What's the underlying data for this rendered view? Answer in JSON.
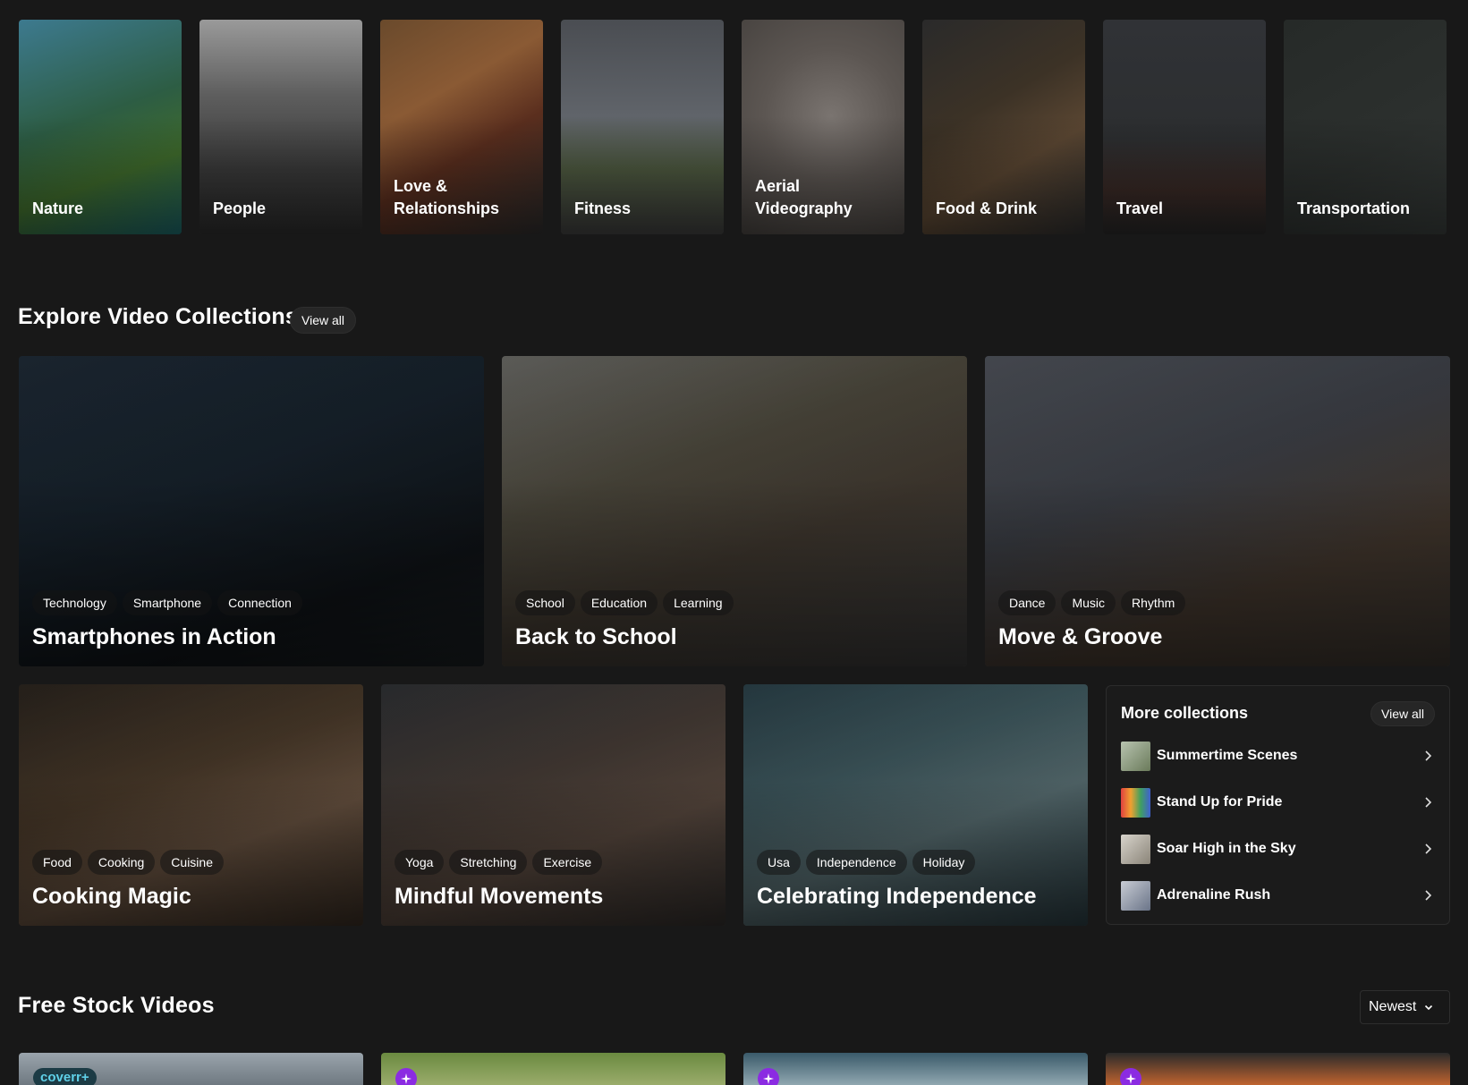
{
  "categories": [
    {
      "label": "Nature",
      "bg": "linear-gradient(160deg,#3d7a8f 0%,#2d5d44 45%,#3f6b2c 70%,#1a5f63 100%)"
    },
    {
      "label": "People",
      "bg": "linear-gradient(180deg,#9a9a9a 0%,#5e5e5e 35%,#3a3a3a 70%,#2a2a2a 100%)"
    },
    {
      "label": "Love &\nRelationships",
      "bg": "linear-gradient(150deg,#6a4a2c 0%,#8a5a34 35%,#5a2e1e 60%,#2a2a2a 100%)"
    },
    {
      "label": "Fitness",
      "bg": "linear-gradient(180deg,#4a4d52 0%,#60646a 45%,#4e5a40 70%,#3b3b3b 100%)"
    },
    {
      "label": "Aerial\nVideography",
      "bg": "radial-gradient(circle at 55% 45%,#7a7470 0%,#5c5652 45%,#44403d 100%)"
    },
    {
      "label": "Food & Drink",
      "bg": "linear-gradient(150deg,#2a2a2a 0%,#3c3226 40%,#5a4632 65%,#2c2c2c 100%)"
    },
    {
      "label": "Travel",
      "bg": "linear-gradient(180deg,#303236 0%,#2c2e30 55%,#3a2a26 80%,#262626 100%)"
    },
    {
      "label": "Transportation",
      "bg": "linear-gradient(150deg,#262a28 0%,#2c302e 60%,#353a38 100%)"
    }
  ],
  "explore": {
    "title": "Explore Video Collections",
    "view_all": "View all"
  },
  "collections_top": [
    {
      "title": "Smartphones in Action",
      "tags": [
        "Technology",
        "Smartphone",
        "Connection"
      ],
      "bg": "linear-gradient(160deg,#1e2a36 0%,#17222c 40%,#101418 75%,#1a1f22 100%)"
    },
    {
      "title": "Back to School",
      "tags": [
        "School",
        "Education",
        "Learning"
      ],
      "bg": "linear-gradient(160deg,#6a6a66 0%,#4e4a3e 35%,#433b32 60%,#3a3a3a 100%)"
    },
    {
      "title": "Move & Groove",
      "tags": [
        "Dance",
        "Music",
        "Rhythm"
      ],
      "bg": "linear-gradient(160deg,#4e525a 0%,#3e4148 40%,#463a30 70%,#3c3630 100%)"
    }
  ],
  "collections_bottom": [
    {
      "title": "Cooking Magic",
      "tags": [
        "Food",
        "Cooking",
        "Cuisine"
      ],
      "bg": "linear-gradient(160deg,#2a241e 0%,#4a3a2a 40%,#6a5442 65%,#3a2e24 100%)"
    },
    {
      "title": "Mindful Movements",
      "tags": [
        "Yoga",
        "Stretching",
        "Exercise"
      ],
      "bg": "linear-gradient(160deg,#2e3034 0%,#463c36 40%,#5a4a40 65%,#34302e 100%)"
    },
    {
      "title": "Celebrating Independence",
      "tags": [
        "Usa",
        "Independence",
        "Holiday"
      ],
      "bg": "linear-gradient(160deg,#2a4048 0%,#405a60 35%,#5a7074 60%,#2c3e44 100%)"
    }
  ],
  "more_collections": {
    "title": "More collections",
    "view_all": "View all",
    "items": [
      {
        "label": "Summertime Scenes",
        "thumb": "linear-gradient(135deg,#b8c4b0,#6a7a5a)"
      },
      {
        "label": "Stand Up for Pride",
        "thumb": "linear-gradient(90deg,#e04040,#f0a030,#40a060,#4060d0)"
      },
      {
        "label": "Soar High in the Sky",
        "thumb": "linear-gradient(135deg,#d8d4cc,#8a8478)"
      },
      {
        "label": "Adrenaline Rush",
        "thumb": "linear-gradient(135deg,#c8ccd4,#6a7488)"
      }
    ]
  },
  "free_stock": {
    "title": "Free Stock Videos",
    "sort": "Newest"
  },
  "videos": [
    {
      "badge": "coverr+",
      "bg": "linear-gradient(180deg,#9aa4ac,#6a747c)"
    },
    {
      "badge": "",
      "bg": "linear-gradient(180deg,#6a8a40,#a0b070)"
    },
    {
      "badge": "",
      "bg": "linear-gradient(180deg,#3a5a6a,#9ab0b8)"
    },
    {
      "badge": "",
      "bg": "linear-gradient(180deg,#2a2a2a,#d06a30)"
    }
  ]
}
